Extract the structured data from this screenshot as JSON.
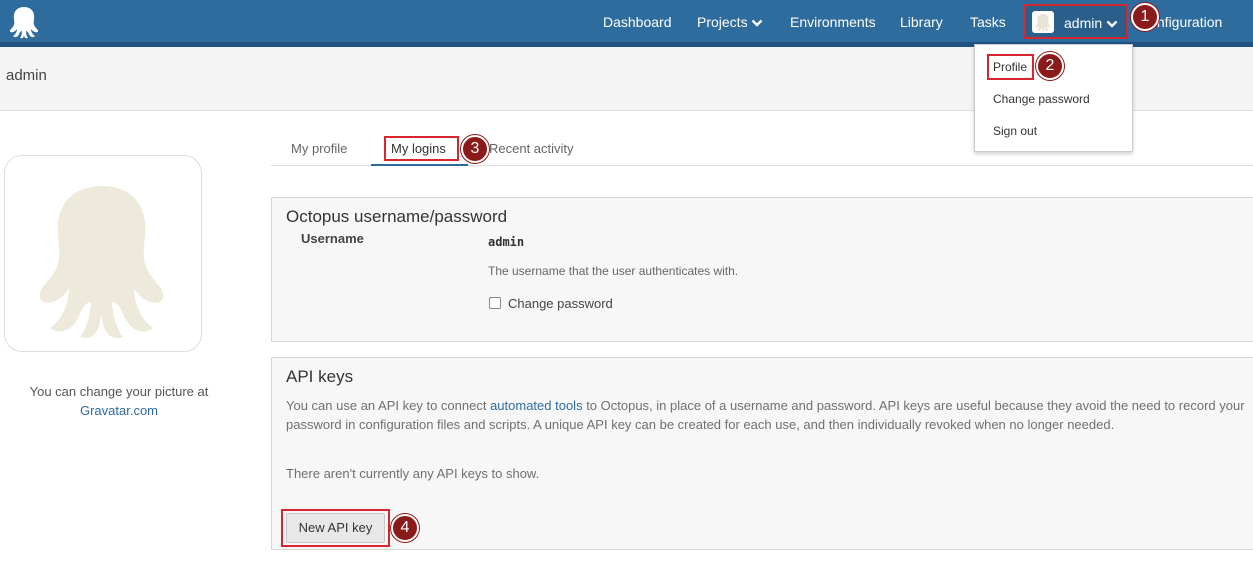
{
  "nav": {
    "dashboard": "Dashboard",
    "projects": "Projects",
    "environments": "Environments",
    "library": "Library",
    "tasks": "Tasks",
    "user": "admin",
    "configuration": "Configuration"
  },
  "dropdown": {
    "profile": "Profile",
    "change_password": "Change password",
    "sign_out": "Sign out"
  },
  "callouts": [
    "1",
    "2",
    "3",
    "4"
  ],
  "page": {
    "title": "admin"
  },
  "avatar": {
    "caption_line1": "You can change your picture at",
    "caption_link": "Gravatar.com"
  },
  "tabs": [
    "My profile",
    "My logins",
    "Recent activity"
  ],
  "login_panel": {
    "title": "Octopus username/password",
    "username_label": "Username",
    "username_value": "admin",
    "username_help": "The username that the user authenticates with.",
    "change_password_label": "Change password"
  },
  "api_panel": {
    "title": "API keys",
    "desc_before_link": "You can use an API key to connect ",
    "desc_link": "automated tools",
    "desc_after_link": " to Octopus, in place of a username and password. API keys are useful because they avoid the need to record your",
    "desc_line2": "password in configuration files and scripts. A unique API key can be created for each use, and then individually revoked when no longer needed.",
    "empty": "There aren't currently any API keys to show.",
    "new_button": "New API key"
  },
  "colors": {
    "nav_bg": "#2f6c9e",
    "highlight": "#d7262e",
    "callout": "#8b1a1a",
    "link": "#2f6c9e"
  }
}
